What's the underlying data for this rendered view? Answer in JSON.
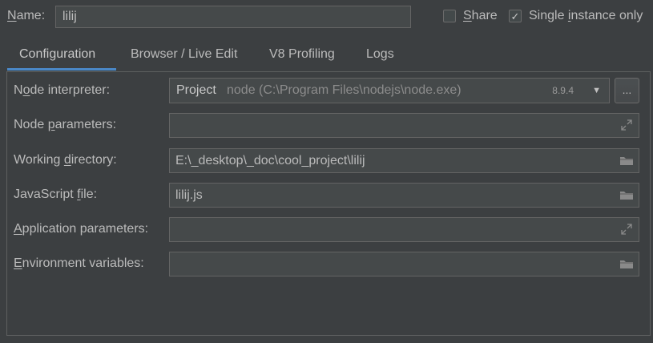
{
  "header": {
    "name_label": "Name:",
    "name_value": "lilij",
    "share_label": "Share",
    "share_checked": false,
    "single_instance_label": "Single instance only",
    "single_instance_checked": true
  },
  "tabs": [
    {
      "label": "Configuration",
      "active": true
    },
    {
      "label": "Browser / Live Edit",
      "active": false
    },
    {
      "label": "V8 Profiling",
      "active": false
    },
    {
      "label": "Logs",
      "active": false
    }
  ],
  "form": {
    "node_interpreter": {
      "label": "Node interpreter:",
      "project": "Project",
      "path": "node (C:\\Program Files\\nodejs\\node.exe)",
      "version": "8.9.4",
      "more_button": "..."
    },
    "node_parameters": {
      "label": "Node parameters:",
      "value": ""
    },
    "working_directory": {
      "label": "Working directory:",
      "value": "E:\\_desktop\\_doc\\cool_project\\lilij"
    },
    "javascript_file": {
      "label": "JavaScript file:",
      "value": "lilij.js"
    },
    "application_parameters": {
      "label": "Application parameters:",
      "value": ""
    },
    "environment_variables": {
      "label": "Environment variables:",
      "value": ""
    }
  },
  "icons": {
    "expand": "expand-icon",
    "folder": "folder-icon",
    "dropdown": "chevron-down-icon",
    "check": "checkmark-icon"
  },
  "colors": {
    "background": "#3c3f41",
    "field": "#45494a",
    "accent": "#4a88c7",
    "text": "#bbbbbb"
  }
}
